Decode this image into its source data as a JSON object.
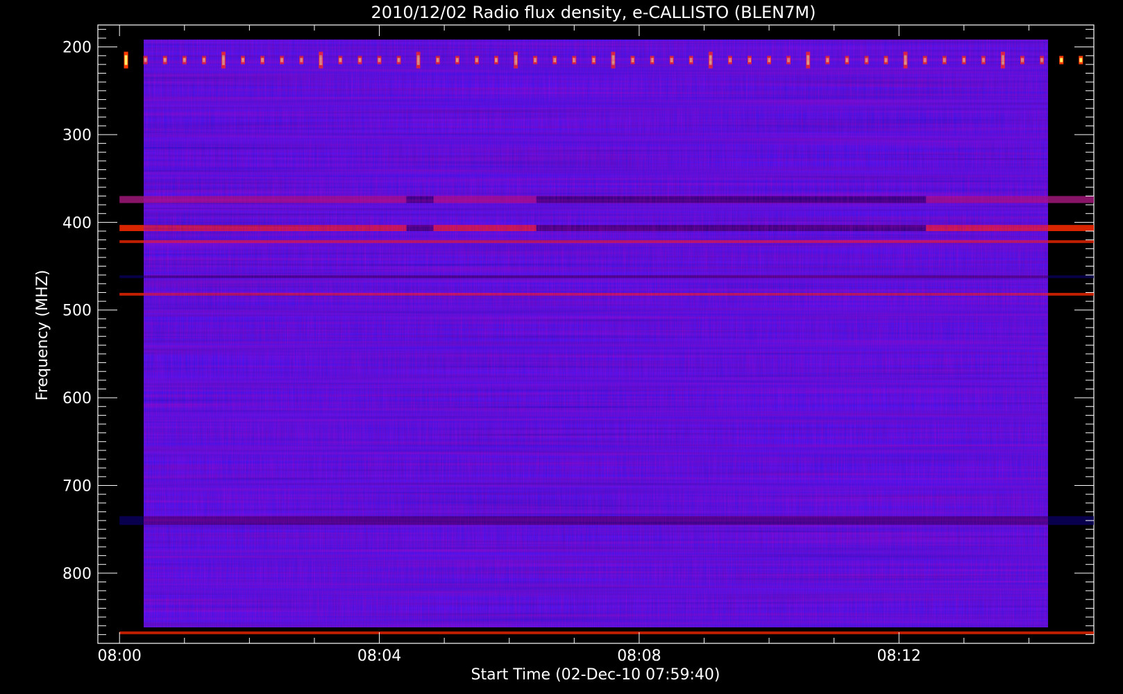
{
  "chart_data": {
    "type": "heatmap",
    "title": "2010/12/02  Radio flux density, e-CALLISTO (BLEN7M)",
    "xlabel": "Start Time (02-Dec-10 07:59:40)",
    "ylabel": "Frequency (MHZ)",
    "xlim": [
      "07:59:40",
      "08:15:00"
    ],
    "ylim": [
      880,
      175
    ],
    "data_extent": {
      "x": [
        "08:00:00",
        "08:15:00"
      ],
      "y": [
        178,
        870
      ]
    },
    "x_ticks": [
      "08:00",
      "08:04",
      "08:08",
      "08:12"
    ],
    "y_ticks": [
      200,
      300,
      400,
      500,
      600,
      700,
      800
    ],
    "colors": {
      "background": "#000000",
      "axes": "#ffffff",
      "base": "#2a1aff",
      "low": "#0a0060",
      "mid": "#a0187a",
      "high": "#ff2a00",
      "peak": "#fffb7a"
    },
    "features": [
      {
        "kind": "periodic-bursts",
        "freq_mhz": 215,
        "period_s": 18,
        "note_colors": [
          "#ff3a00",
          "#ffee66"
        ]
      },
      {
        "kind": "band",
        "freq_mhz": [
          370,
          378
        ],
        "segments": [
          [
            "08:00:00",
            "08:04:25",
            "mid"
          ],
          [
            "08:04:25",
            "08:04:50",
            "low"
          ],
          [
            "08:04:50",
            "08:06:25",
            "mid"
          ],
          [
            "08:06:25",
            "08:12:25",
            "low"
          ],
          [
            "08:12:25",
            "08:15:00",
            "mid"
          ]
        ]
      },
      {
        "kind": "band",
        "freq_mhz": [
          403,
          410
        ],
        "segments": [
          [
            "08:00:00",
            "08:04:25",
            "high"
          ],
          [
            "08:04:25",
            "08:04:50",
            "low"
          ],
          [
            "08:04:50",
            "08:06:25",
            "high"
          ],
          [
            "08:06:25",
            "08:12:25",
            "low"
          ],
          [
            "08:12:25",
            "08:15:00",
            "high"
          ]
        ]
      },
      {
        "kind": "line",
        "freq_mhz": 422,
        "color": "high"
      },
      {
        "kind": "line",
        "freq_mhz": 462,
        "color": "low"
      },
      {
        "kind": "line",
        "freq_mhz": 482,
        "color": "high"
      },
      {
        "kind": "band",
        "freq_mhz": [
          735,
          745
        ],
        "color": "low"
      },
      {
        "kind": "line",
        "freq_mhz": 868,
        "color": "high"
      }
    ]
  }
}
